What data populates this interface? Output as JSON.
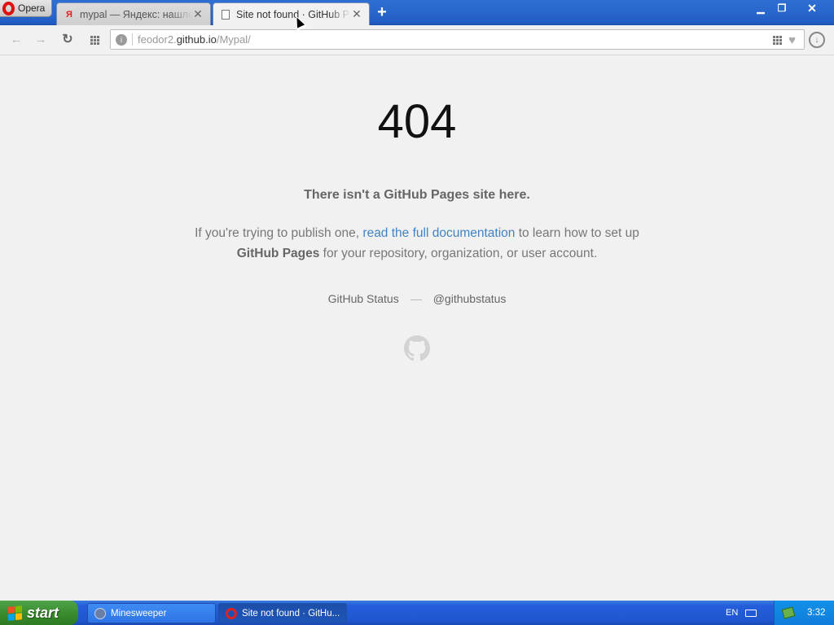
{
  "browser": {
    "menu_label": "Opera",
    "tabs": [
      {
        "title": "mypal — Яндекс: нашлось",
        "favicon": "Я",
        "active": false
      },
      {
        "title": "Site not found · GitHub Pages",
        "active": true
      }
    ],
    "new_tab_icon": "plus-icon",
    "address": {
      "prefix": "feodor2.",
      "domain": "github.io",
      "path": "/Mypal/"
    }
  },
  "page": {
    "code": "404",
    "subtitle": "There isn't a GitHub Pages site here.",
    "desc_before": "If you're trying to publish one, ",
    "desc_link": "read the full documentation",
    "desc_middle": " to learn how to set up ",
    "desc_strong": "GitHub Pages",
    "desc_after": " for your repository, organization, or user account.",
    "status_link": "GitHub Status",
    "twitter_link": "@githubstatus"
  },
  "taskbar": {
    "start_label": "start",
    "tasks": [
      {
        "label": "Minesweeper"
      },
      {
        "label": "Site not found · GitHu..."
      }
    ],
    "language": "EN",
    "clock": "3:32"
  },
  "colors": {
    "link": "#4183c4",
    "taskbar_blue": "#245edb",
    "start_green": "#3b8c2f"
  }
}
